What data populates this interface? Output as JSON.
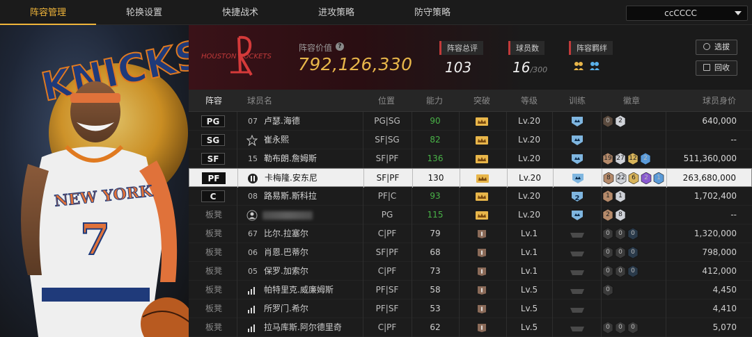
{
  "nav": {
    "tabs": [
      "阵容管理",
      "轮换设置",
      "快捷战术",
      "进攻策略",
      "防守策略"
    ],
    "active_tab": 0,
    "selector_value": "ccCCCC"
  },
  "banner": {
    "team_logo_text": "HOUSTON ROCKETS",
    "lineup_value_label": "阵容价值",
    "lineup_value": "792,126,330",
    "stats": [
      {
        "label": "阵容总评",
        "value": "103",
        "suffix": ""
      },
      {
        "label": "球员数",
        "value": "16",
        "suffix": "/300"
      },
      {
        "label": "阵容羁绊",
        "value": "",
        "suffix": ""
      }
    ],
    "buttons": {
      "select": "选拔",
      "recycle": "回收"
    }
  },
  "table": {
    "headers": [
      "阵容",
      "球员名",
      "位置",
      "能力",
      "突破",
      "等级",
      "训练",
      "徽章",
      "球员身价"
    ],
    "rows": [
      {
        "slot": "PG",
        "bench": false,
        "jersey": "07",
        "jersey_icon": "",
        "name": "卢瑟.海德",
        "position": "PG|SG",
        "ability": "90",
        "ability_green": true,
        "crown": "gold",
        "level": "Lv.20",
        "train": "blue",
        "badges": [
          [
            "0",
            "bronze-dark"
          ],
          [
            "2",
            "silver"
          ]
        ],
        "value": "640,000",
        "selected": false
      },
      {
        "slot": "SG",
        "bench": false,
        "jersey": "",
        "jersey_icon": "star-icon",
        "name": "崔永熙",
        "position": "SF|SG",
        "ability": "82",
        "ability_green": true,
        "crown": "gold",
        "level": "Lv.20",
        "train": "blue",
        "badges": [],
        "value": "--",
        "selected": false
      },
      {
        "slot": "SF",
        "bench": false,
        "jersey": "15",
        "jersey_icon": "",
        "name": "勒布朗.詹姆斯",
        "position": "SF|PF",
        "ability": "136",
        "ability_green": true,
        "crown": "gold",
        "level": "Lv.20",
        "train": "blue",
        "badges": [
          [
            "19",
            "bronze"
          ],
          [
            "27",
            "silver"
          ],
          [
            "12",
            "gold"
          ],
          [
            "2",
            "blue"
          ]
        ],
        "value": "511,360,000",
        "selected": false
      },
      {
        "slot": "PF",
        "bench": false,
        "jersey": "",
        "jersey_icon": "eleven-icon",
        "name": "卡梅隆.安东尼",
        "position": "SF|PF",
        "ability": "130",
        "ability_green": false,
        "crown": "gold",
        "level": "Lv.20",
        "train": "blue",
        "badges": [
          [
            "8",
            "bronze"
          ],
          [
            "22",
            "silver"
          ],
          [
            "6",
            "gold"
          ],
          [
            "2",
            "purple"
          ],
          [
            "1",
            "blue"
          ]
        ],
        "value": "263,680,000",
        "selected": true
      },
      {
        "slot": "C",
        "bench": false,
        "jersey": "08",
        "jersey_icon": "",
        "name": "路易斯.斯科拉",
        "position": "PF|C",
        "ability": "93",
        "ability_green": true,
        "crown": "gold",
        "level": "Lv.20",
        "train": "blue2",
        "badges": [
          [
            "1",
            "bronze"
          ],
          [
            "1",
            "silver"
          ]
        ],
        "value": "1,702,400",
        "selected": false
      },
      {
        "slot": "板凳",
        "bench": true,
        "jersey": "",
        "jersey_icon": "person-icon",
        "name": "",
        "blurred": true,
        "position": "PG",
        "ability": "115",
        "ability_green": true,
        "crown": "gold",
        "level": "Lv.20",
        "train": "blue",
        "badges": [
          [
            "2",
            "bronze"
          ],
          [
            "8",
            "silver"
          ]
        ],
        "value": "--",
        "selected": false
      },
      {
        "slot": "板凳",
        "bench": true,
        "jersey": "67",
        "jersey_icon": "",
        "name": "比尔.拉塞尔",
        "position": "C|PF",
        "ability": "79",
        "ability_green": false,
        "crown": "brown",
        "level": "Lv.1",
        "train": "gray",
        "badges": [
          [
            "0",
            "dark"
          ],
          [
            "0",
            "dark"
          ],
          [
            "0",
            "dark-blue"
          ]
        ],
        "value": "1,320,000",
        "selected": false
      },
      {
        "slot": "板凳",
        "bench": true,
        "jersey": "06",
        "jersey_icon": "",
        "name": "肖恩.巴蒂尔",
        "position": "SF|PF",
        "ability": "68",
        "ability_green": false,
        "crown": "brown",
        "level": "Lv.1",
        "train": "gray",
        "badges": [
          [
            "0",
            "dark"
          ],
          [
            "0",
            "dark"
          ],
          [
            "0",
            "dark-blue"
          ]
        ],
        "value": "798,000",
        "selected": false
      },
      {
        "slot": "板凳",
        "bench": true,
        "jersey": "05",
        "jersey_icon": "",
        "name": "保罗.加索尔",
        "position": "C|PF",
        "ability": "73",
        "ability_green": false,
        "crown": "brown",
        "level": "Lv.1",
        "train": "gray",
        "badges": [
          [
            "0",
            "dark"
          ],
          [
            "0",
            "dark"
          ],
          [
            "0",
            "dark-blue"
          ]
        ],
        "value": "412,000",
        "selected": false
      },
      {
        "slot": "板凳",
        "bench": true,
        "jersey": "",
        "jersey_icon": "bars-icon",
        "name": "帕特里克.威廉姆斯",
        "position": "PF|SF",
        "ability": "58",
        "ability_green": false,
        "crown": "brown",
        "level": "Lv.5",
        "train": "gray",
        "badges": [
          [
            "0",
            "dark"
          ]
        ],
        "value": "4,450",
        "selected": false
      },
      {
        "slot": "板凳",
        "bench": true,
        "jersey": "",
        "jersey_icon": "bars-icon",
        "name": "所罗门.希尔",
        "position": "PF|SF",
        "ability": "53",
        "ability_green": false,
        "crown": "brown",
        "level": "Lv.5",
        "train": "gray",
        "badges": [],
        "value": "4,410",
        "selected": false
      },
      {
        "slot": "板凳",
        "bench": true,
        "jersey": "",
        "jersey_icon": "bars-icon",
        "name": "拉马库斯.阿尔德里奇",
        "position": "C|PF",
        "ability": "62",
        "ability_green": false,
        "crown": "brown",
        "level": "Lv.5",
        "train": "gray",
        "badges": [
          [
            "0",
            "dark"
          ],
          [
            "0",
            "dark"
          ],
          [
            "0",
            "dark"
          ]
        ],
        "value": "5,070",
        "selected": false
      }
    ]
  },
  "player_art": {
    "jersey_text": "NEW YORK",
    "jersey_number": "7",
    "backdrop_text": "KNICKS"
  },
  "colors": {
    "accent": "#f0b53a",
    "ability_green": "#49b347",
    "value_gold": "#e8b64a",
    "stat_mark": "#c23a3a"
  }
}
